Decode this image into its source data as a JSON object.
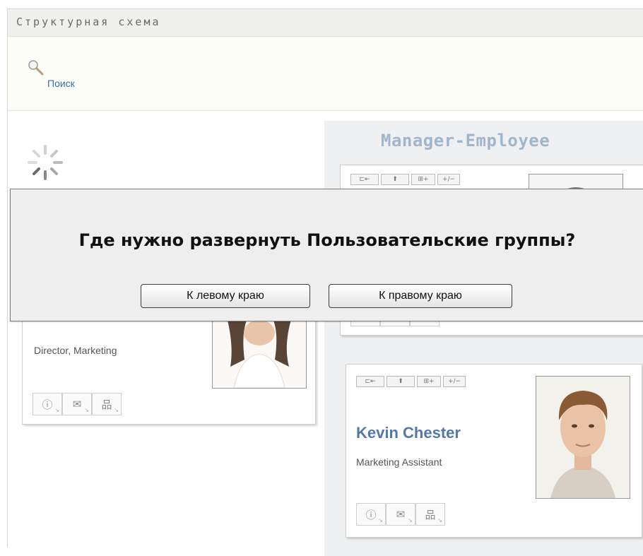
{
  "header": {
    "title": "Структурная схема"
  },
  "search": {
    "link_label": "Поиск",
    "icon": "magnifier-icon"
  },
  "loading": {
    "icon": "spinner-icon"
  },
  "chart": {
    "relationship_title": "Manager-Employee",
    "card_toolbar_buttons": [
      "⊏⇤",
      "⬆",
      "⊞+",
      "+/−"
    ],
    "card_action_icons": [
      "info-icon",
      "email-icon",
      "org-chart-icon"
    ]
  },
  "left_card": {
    "role": "Director, Marketing"
  },
  "employee_card": {
    "name": "Kevin Chester",
    "role": "Marketing Assistant"
  },
  "dialog": {
    "question": "Где нужно развернуть Пользовательские группы?",
    "left_button": "К левому краю",
    "right_button": "К правому краю"
  },
  "colors": {
    "link": "#3b6ea8",
    "name": "#5578a8",
    "relationship_title": "#9fb6cc",
    "dialog_bg": "#eeeeee"
  }
}
